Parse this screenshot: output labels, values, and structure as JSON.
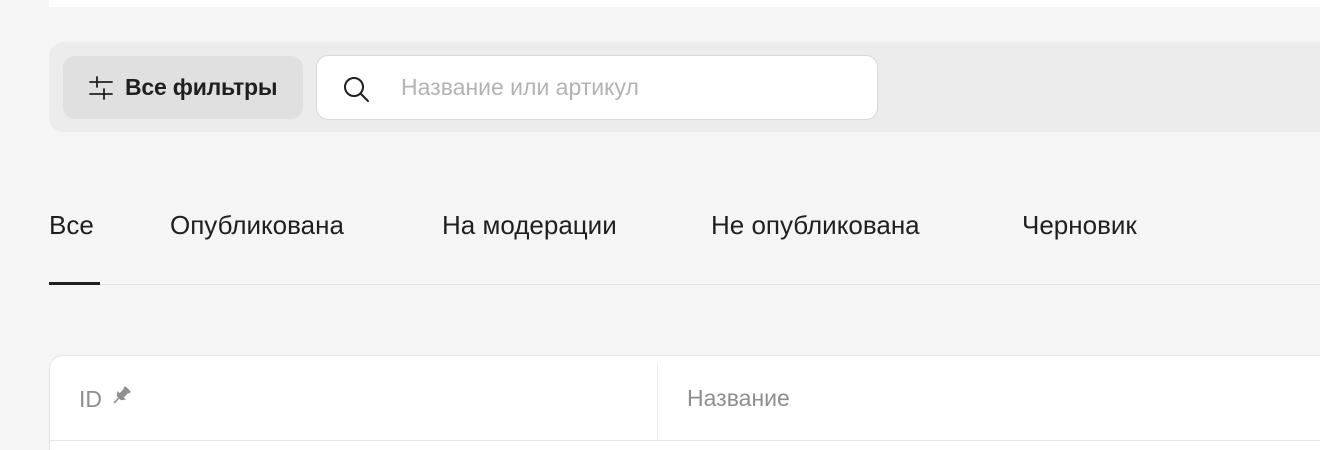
{
  "filters": {
    "button_label": "Все фильтры",
    "icon": "sliders-icon"
  },
  "search": {
    "placeholder": "Название или артикул",
    "value": "",
    "icon": "search-icon"
  },
  "tabs": [
    {
      "label": "Все",
      "active": true
    },
    {
      "label": "Опубликована",
      "active": false
    },
    {
      "label": "На модерации",
      "active": false
    },
    {
      "label": "Не опубликована",
      "active": false
    },
    {
      "label": "Черновик",
      "active": false
    }
  ],
  "table": {
    "columns": [
      {
        "label": "ID",
        "pinned": true,
        "icon": "pin-icon"
      },
      {
        "label": "Название",
        "pinned": false
      }
    ]
  },
  "colors": {
    "background": "#f5f5f5",
    "filter_bar": "#ececec",
    "text": "#1f1f1f",
    "muted": "#8e8e8e"
  }
}
